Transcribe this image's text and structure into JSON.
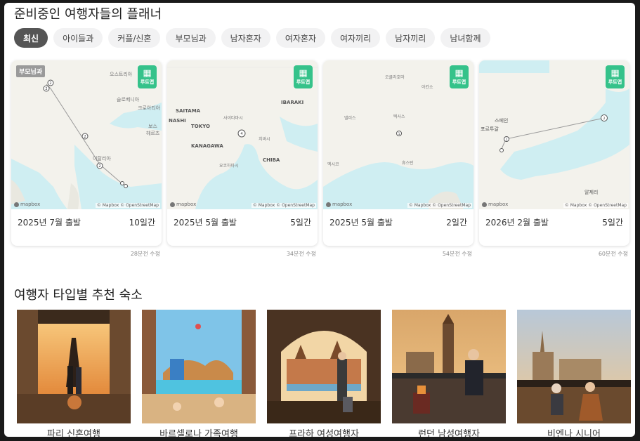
{
  "planner_section": {
    "title": "준비중인 여행자들의 플래너",
    "filters": [
      "최신",
      "아이들과",
      "커플/신혼",
      "부모님과",
      "남자혼자",
      "여자혼자",
      "여자끼리",
      "남자끼리",
      "남녀함께"
    ],
    "active_filter": 0,
    "route_badge_label": "루트맵",
    "mapbox_label": "mapbox",
    "attribution": "© Mapbox © OpenStreetMap",
    "cards": [
      {
        "tag": "부모님과",
        "departure": "2025년 7월 출발",
        "duration": "10일간",
        "updated": "28분전 수정",
        "map_labels": [
          "오스트리아",
          "슬로베니아",
          "크로아티아",
          "보스",
          "헤르츠",
          "이탈리아"
        ],
        "markers": [
          "2",
          "2",
          "2",
          "2"
        ]
      },
      {
        "tag": "",
        "departure": "2025년 5월 출발",
        "duration": "5일간",
        "updated": "34분전 수정",
        "map_labels": [
          "SAITAMA",
          "NASHI",
          "TOKYO",
          "IBARAKI",
          "KANAGAWA",
          "CHIBA",
          "사이타마시",
          "치바시",
          "요코하마시"
        ],
        "markers": [
          "4"
        ]
      },
      {
        "tag": "",
        "departure": "2025년 5월 출발",
        "duration": "2일간",
        "updated": "54분전 수정",
        "map_labels": [
          "오클라호마",
          "아칸소",
          "댈러스",
          "텍사스",
          "휴스턴",
          "멕시코"
        ],
        "markers": [
          "1"
        ]
      },
      {
        "tag": "",
        "departure": "2026년 2월 출발",
        "duration": "5일간",
        "updated": "60분전 수정",
        "map_labels": [
          "스페인",
          "포르투갈",
          "알제리"
        ],
        "markers": [
          "1",
          "2"
        ]
      }
    ]
  },
  "stay_section": {
    "title": "여행자 타입별 추천 숙소",
    "hotels": [
      {
        "name": "파리 신혼여행",
        "scene": "eiffel-balcony"
      },
      {
        "name": "바르셀로나 가족여행",
        "scene": "park-guell-pool"
      },
      {
        "name": "프라하 여성여행자",
        "scene": "prague-window"
      },
      {
        "name": "런던 남성여행자",
        "scene": "big-ben-terrace"
      },
      {
        "name": "비엔나 시니어",
        "scene": "vienna-terrace"
      }
    ]
  }
}
